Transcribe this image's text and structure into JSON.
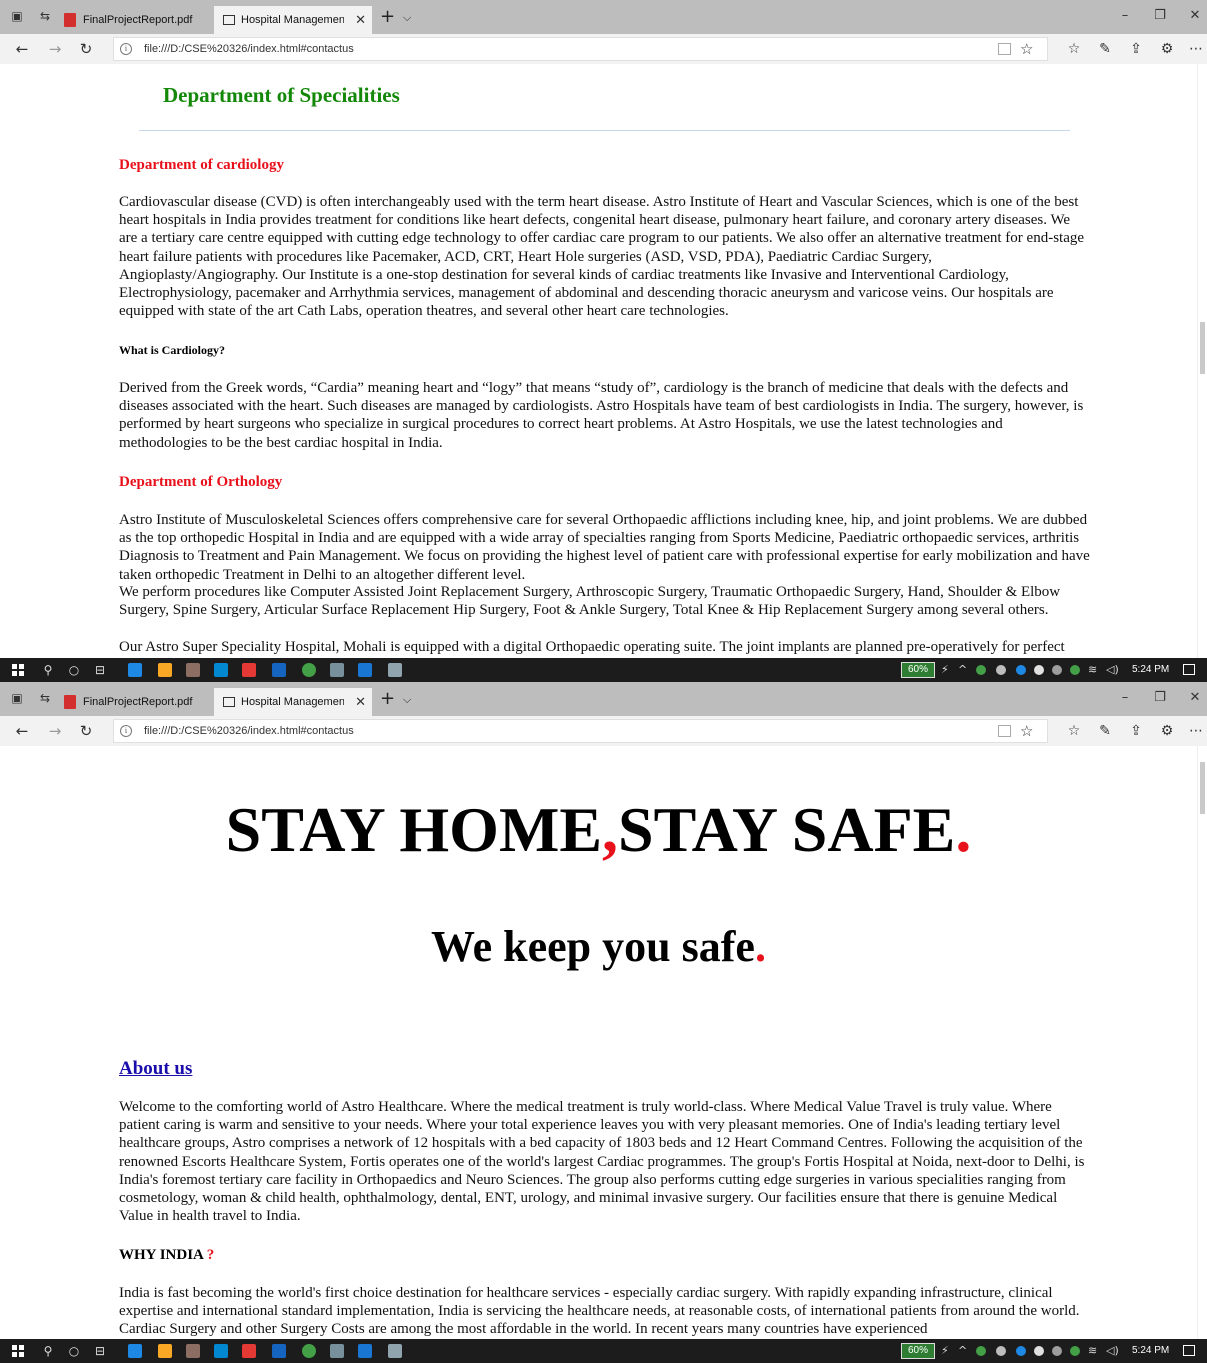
{
  "browser": {
    "tabs": [
      {
        "label": "FinalProjectReport.pdf"
      },
      {
        "label": "Hospital Management S"
      }
    ],
    "url": "file:///D:/CSE%20326/index.html#contactus"
  },
  "taskbar": {
    "battery": "60%",
    "time": "5:24 PM"
  },
  "specialities": {
    "title": "Department of Specialities",
    "cardiology": {
      "heading": "Department of cardiology",
      "body": "Cardiovascular disease (CVD) is often interchangeably used with the term heart disease. Astro Institute of Heart and Vascular Sciences, which is one of the best heart hospitals in India provides treatment for conditions like heart defects, congenital heart disease, pulmonary heart failure, and coronary artery diseases. We are a tertiary care centre equipped with cutting edge technology to offer cardiac care program to our patients. We also offer an alternative treatment for end-stage heart failure patients with procedures like Pacemaker, ACD, CRT, Heart Hole surgeries (ASD, VSD, PDA), Paediatric Cardiac Surgery, Angioplasty/Angiography. Our Institute is a one-stop destination for several kinds of cardiac treatments like Invasive and Interventional Cardiology, Electrophysiology, pacemaker and Arrhythmia services, management of abdominal and descending thoracic aneurysm and varicose veins. Our hospitals are equipped with state of the art Cath Labs, operation theatres, and several other heart care technologies.",
      "question": "What is Cardiology?",
      "answer": "Derived from the Greek words, “Cardia” meaning heart and “logy” that means “study of”, cardiology is the branch of medicine that deals with the defects and diseases associated with the heart. Such diseases are managed by cardiologists. Astro Hospitals have team of best cardiologists in India. The surgery, however, is performed by heart surgeons who specialize in surgical procedures to correct heart problems. At Astro Hospitals, we use the latest technologies and methodologies to be the best cardiac hospital in India."
    },
    "orthology": {
      "heading": "Department of Orthology",
      "body1": "Astro Institute of Musculoskeletal Sciences offers comprehensive care for several Orthopaedic afflictions including knee, hip, and joint problems. We are dubbed as the top orthopedic Hospital in India and are equipped with a wide array of specialties ranging from Sports Medicine, Paediatric orthopaedic services, arthritis Diagnosis to Treatment and Pain Management. We focus on providing the highest level of patient care with professional expertise for early mobilization and have taken orthopedic Treatment in Delhi to an altogether different level.",
      "body2": "We perform procedures like Computer Assisted Joint Replacement Surgery, Arthroscopic Surgery, Traumatic Orthopaedic Surgery, Hand, Shoulder & Elbow Surgery, Spine Surgery, Articular Surface Replacement Hip Surgery, Foot & Ankle Surgery, Total Knee & Hip Replacement Surgery among several others.",
      "body3": "Our Astro Super Speciality Hospital, Mohali is equipped with a digital Orthopaedic operating suite. The joint implants are planned pre-operatively for perfect size and positioning as per the anatomy of the patient, thereby safeguarding the patients. Our wide range of offerings have made us rank among"
    }
  },
  "hero": {
    "line1_a": "STAY HOME",
    "line1_comma": ",",
    "line1_b": "STAY SAFE",
    "line1_dot": ".",
    "line2": "We keep you safe",
    "line2_dot": "."
  },
  "about": {
    "link": "About us",
    "body": "Welcome to the comforting world of Astro Healthcare. Where the medical treatment is truly world-class. Where Medical Value Travel is truly value. Where patient caring is warm and sensitive to your needs. Where your total experience leaves you with very pleasant memories. One of India's leading tertiary level healthcare groups, Astro comprises a network of 12 hospitals with a bed capacity of 1803 beds and 12 Heart Command Centres. Following the acquisition of the renowned Escorts Healthcare System, Fortis operates one of the world's largest Cardiac programmes. The group's Fortis Hospital at Noida, next-door to Delhi, is India's foremost tertiary care facility in Orthopaedics and Neuro Sciences. The group also performs cutting edge surgeries in various specialities ranging from cosmetology, woman & child health, ophthalmology, dental, ENT, urology, and minimal invasive surgery. Our facilities ensure that there is genuine Medical Value in health travel to India.",
    "why_label": "WHY INDIA",
    "why_mark": "?",
    "why_body": "India is fast becoming the world's first choice destination for healthcare services - especially cardiac surgery. With rapidly expanding infrastructure, clinical expertise and international standard implementation, India is servicing the healthcare needs, at reasonable costs, of international patients from around the world. Cardiac Surgery and other Surgery Costs are among the most affordable in the world. In recent years many countries have experienced"
  }
}
